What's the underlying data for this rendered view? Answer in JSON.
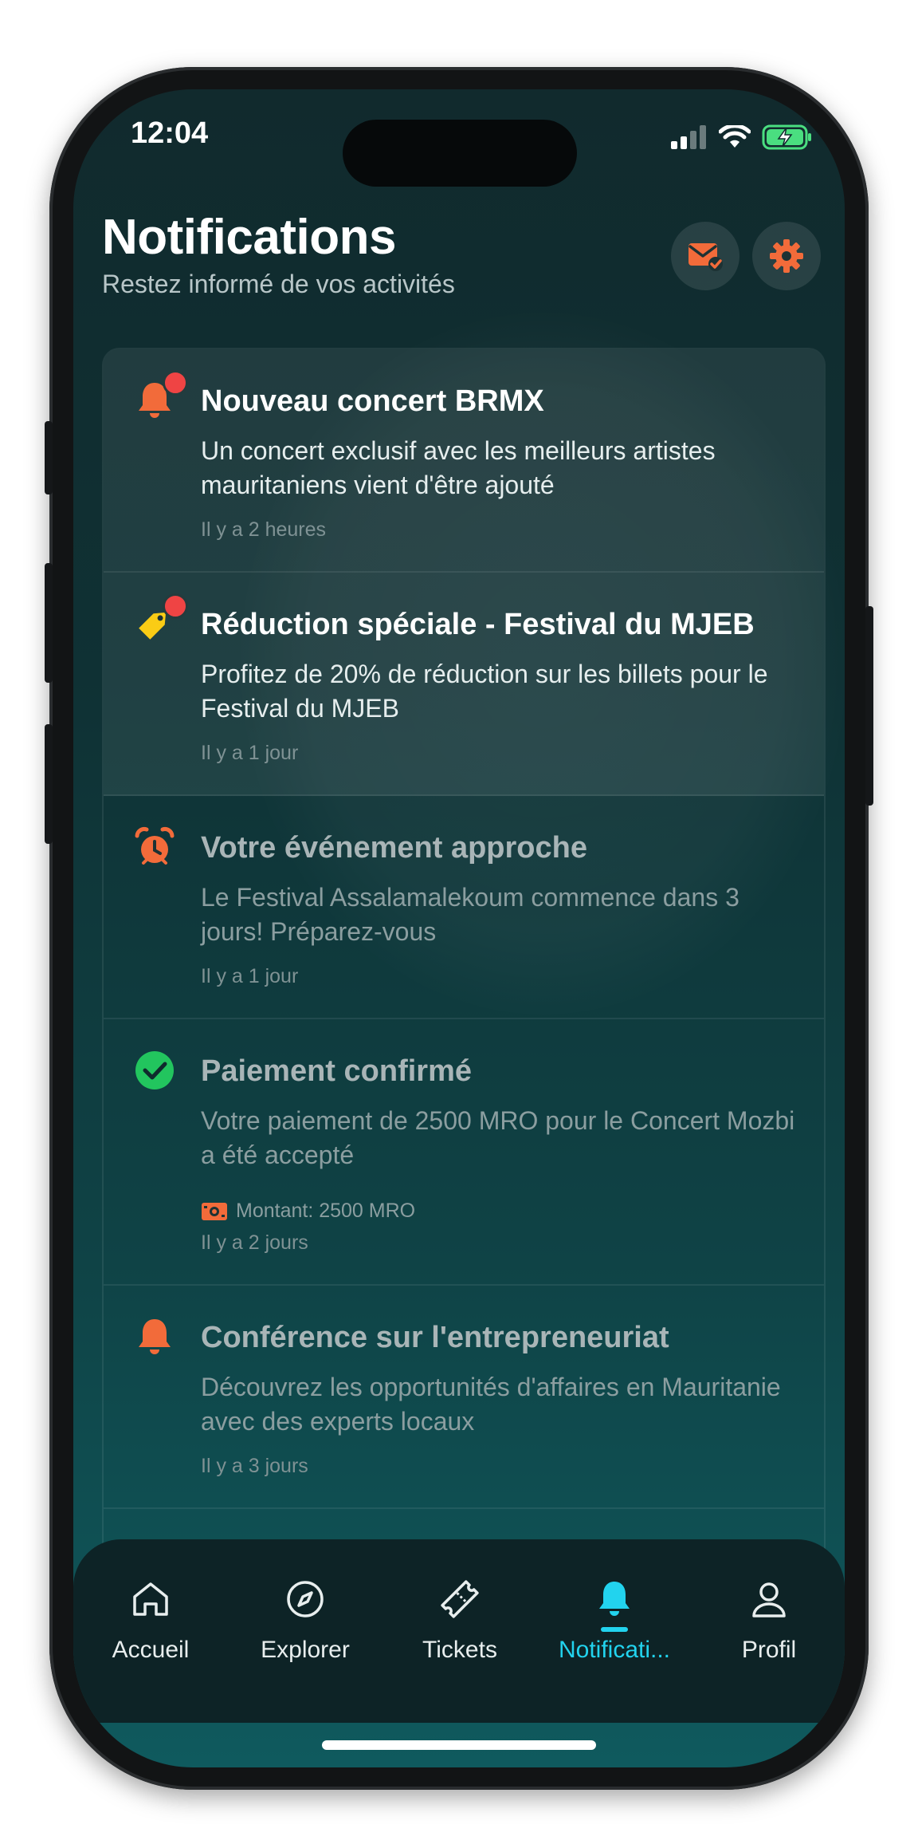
{
  "status_bar": {
    "time": "12:04"
  },
  "header": {
    "title": "Notifications",
    "subtitle": "Restez informé de vos activités",
    "actions": [
      {
        "name": "mark-all-read",
        "icon": "mail-check-icon"
      },
      {
        "name": "settings",
        "icon": "gear-icon"
      }
    ]
  },
  "colors": {
    "accent": "#22d3ee",
    "icon_orange": "#f26b3a",
    "unread_dot": "#ef4444",
    "success_green": "#22c55e",
    "tag_yellow": "#facc15"
  },
  "notifications": [
    {
      "title": "Nouveau concert BRMX",
      "body": "Un concert exclusif avec les meilleurs artistes mauritaniens vient d'être ajouté",
      "time": "Il y a 2 heures",
      "icon": "bell-icon",
      "unread": true
    },
    {
      "title": "Réduction spéciale - Festival du MJEB",
      "body": "Profitez de 20% de réduction sur les billets pour le Festival du MJEB",
      "time": "Il y a 1 jour",
      "icon": "tag-icon",
      "unread": true
    },
    {
      "title": "Votre événement approche",
      "body": "Le Festival Assalamalekoum commence dans 3 jours! Préparez-vous",
      "time": "Il y a 1 jour",
      "icon": "alarm-clock-icon",
      "unread": false
    },
    {
      "title": "Paiement confirmé",
      "body": "Votre paiement de 2500 MRO pour le Concert Mozbi a été accepté",
      "amount": "Montant: 2500 MRO",
      "time": "Il y a 2 jours",
      "icon": "check-circle-icon",
      "unread": false
    },
    {
      "title": "Conférence sur l'entrepreneuriat",
      "body": "Découvrez les opportunités d'affaires en Mauritanie avec des experts locaux",
      "time": "Il y a 3 jours",
      "icon": "bell-icon",
      "unread": false
    }
  ],
  "tabbar": {
    "items": [
      {
        "label": "Accueil",
        "icon": "home-icon",
        "active": false
      },
      {
        "label": "Explorer",
        "icon": "compass-icon",
        "active": false
      },
      {
        "label": "Tickets",
        "icon": "ticket-icon",
        "active": false
      },
      {
        "label": "Notificati...",
        "icon": "bell-icon",
        "active": true
      },
      {
        "label": "Profil",
        "icon": "user-icon",
        "active": false
      }
    ]
  }
}
